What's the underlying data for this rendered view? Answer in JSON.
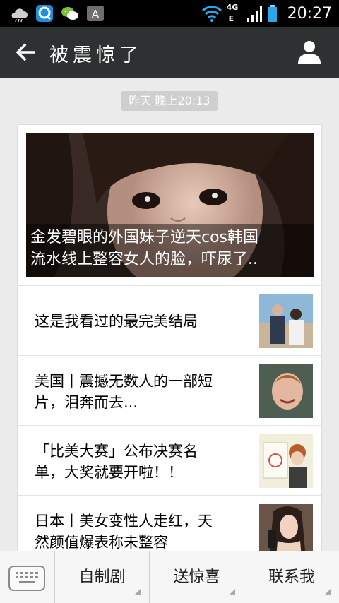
{
  "status_bar": {
    "time": "20:27",
    "network_4g": "4G",
    "network_e": "E",
    "icons": [
      "cloud-icon",
      "qq-icon",
      "wechat-icon",
      "keyboard-a-icon",
      "wifi-icon",
      "signal-icon",
      "battery-icon"
    ]
  },
  "header": {
    "title": "被震惊了",
    "back_icon": "back-arrow-icon",
    "profile_icon": "person-icon"
  },
  "timestamp": "昨天 晚上20:13",
  "article_card": {
    "cover": {
      "title_line1": "金发碧眼的外国妹子逆天cos韩国",
      "title_line2": "流水线上整容女人的脸，吓尿了.."
    },
    "items": [
      {
        "line1": "这是我看过的最完美结局",
        "line2": ""
      },
      {
        "line1": "美国丨震撼无数人的一部短",
        "line2": "片，泪奔而去..."
      },
      {
        "line1": "「比美大赛」公布决赛名",
        "line2": "单，大奖就要开啦！！"
      },
      {
        "line1": "日本丨美女变性人走红，天",
        "line2": "然颜值爆表称未整容"
      }
    ]
  },
  "bottom_menu": {
    "keyboard_icon": "keyboard-icon",
    "items": [
      {
        "label": "自制剧"
      },
      {
        "label": "送惊喜"
      },
      {
        "label": "联系我"
      }
    ]
  },
  "colors": {
    "title_bar": "#2d3132",
    "page_bg": "#ebebeb",
    "timestamp_bg": "#cfcfcf"
  }
}
